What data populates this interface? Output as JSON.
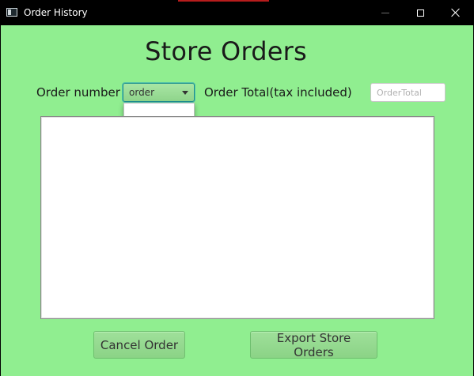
{
  "window": {
    "title": "Order History",
    "title_icon": "app-window-icon",
    "controls": {
      "minimize_icon": "minimize-icon",
      "maximize_icon": "maximize-icon",
      "close_icon": "close-icon"
    }
  },
  "page": {
    "heading": "Store Orders",
    "background_color": "#90ee90"
  },
  "order_number": {
    "label": "Order number",
    "selected_value": "order",
    "options": []
  },
  "order_total": {
    "label": "Order Total(tax included)",
    "value": "",
    "placeholder": "OrderTotal"
  },
  "orders_text": {
    "value": ""
  },
  "buttons": {
    "cancel_label": "Cancel Order",
    "export_label": "Export Store Orders"
  }
}
